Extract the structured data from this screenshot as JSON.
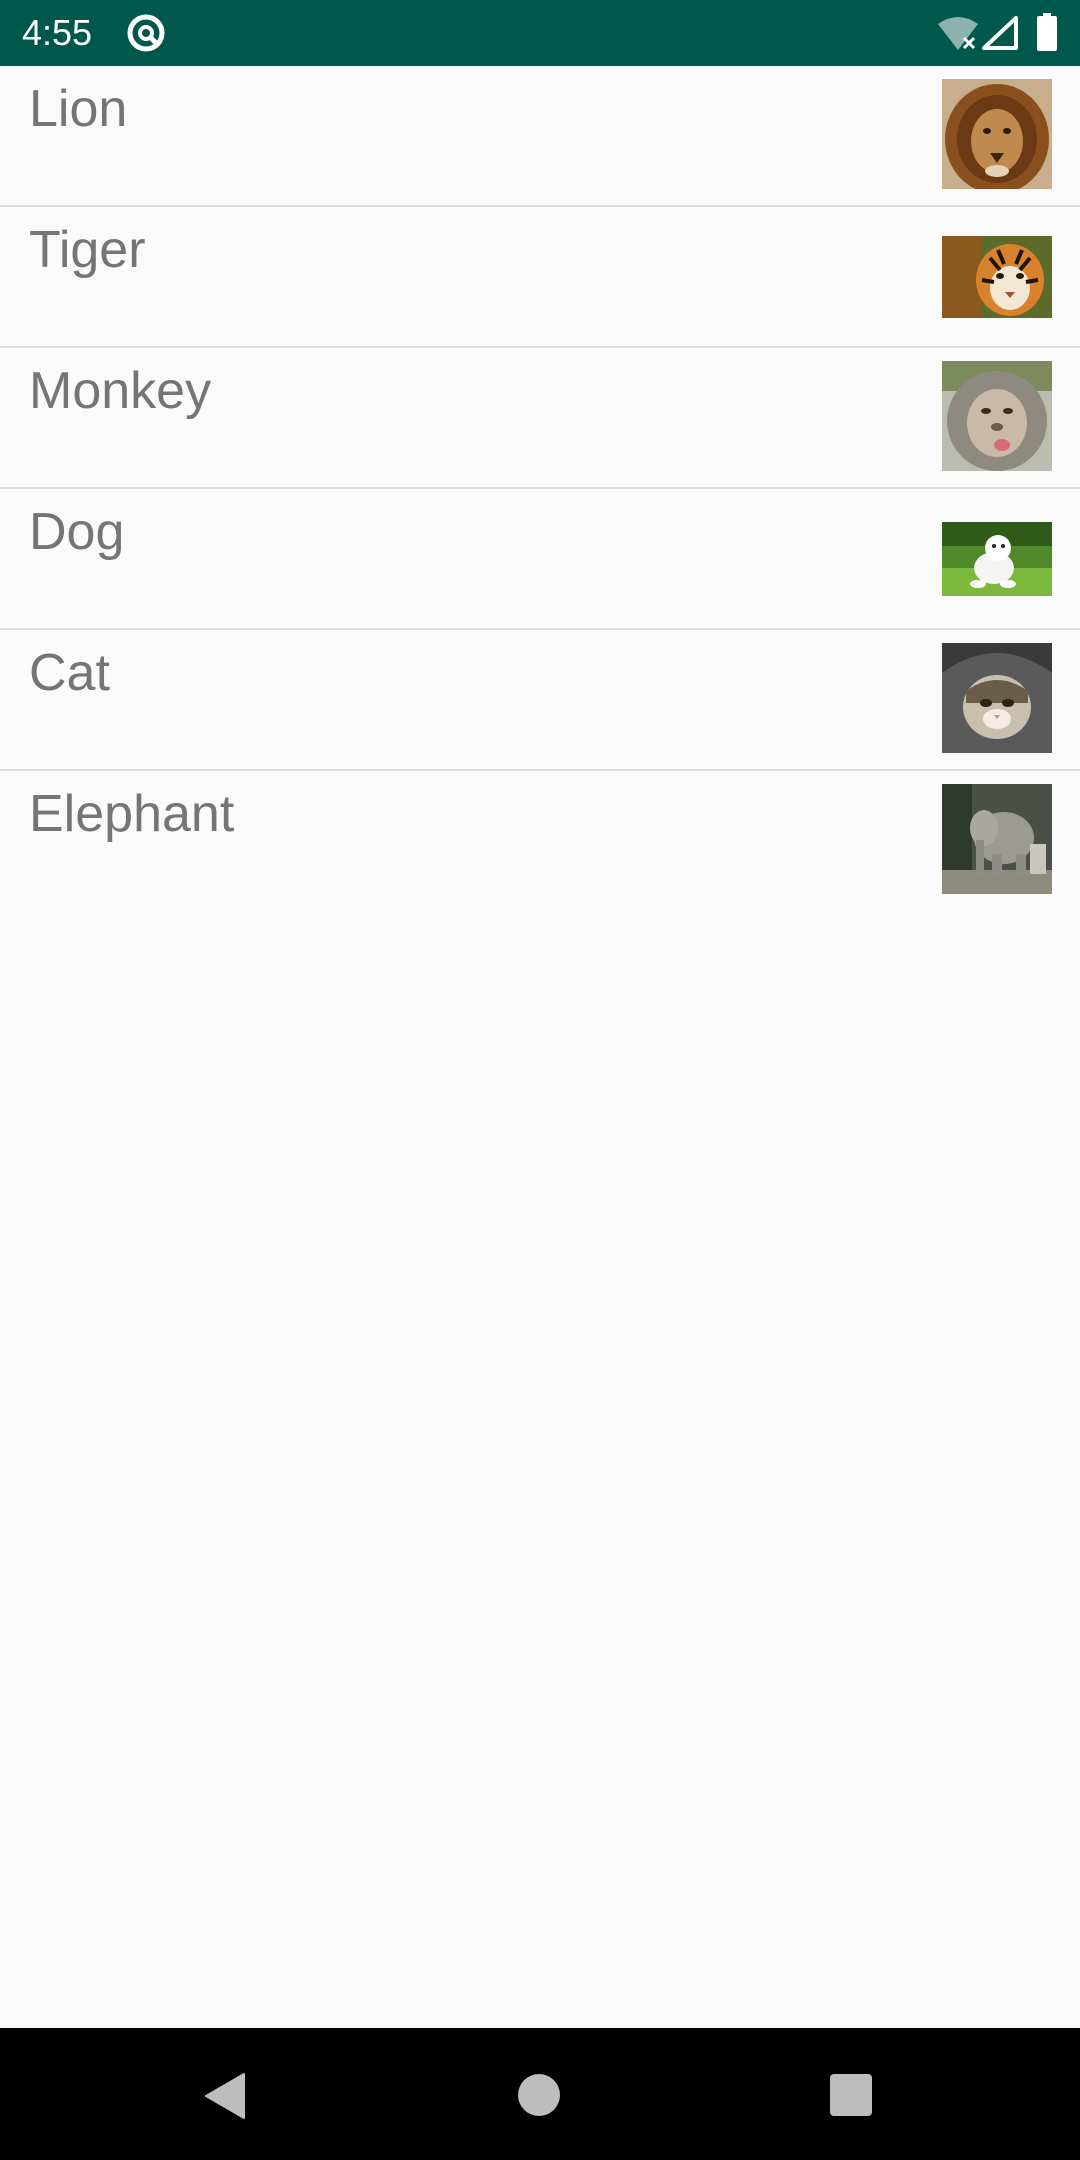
{
  "status_bar": {
    "time": "4:55",
    "background_color": "#00574b",
    "icons": [
      "app-notification-icon",
      "wifi-off-icon",
      "cell-signal-icon",
      "battery-icon"
    ]
  },
  "animals": {
    "items": [
      {
        "label": "Lion",
        "image": "lion-photo"
      },
      {
        "label": "Tiger",
        "image": "tiger-photo"
      },
      {
        "label": "Monkey",
        "image": "monkey-photo"
      },
      {
        "label": "Dog",
        "image": "dog-photo"
      },
      {
        "label": "Cat",
        "image": "cat-photo"
      },
      {
        "label": "Elephant",
        "image": "elephant-photo"
      }
    ]
  },
  "nav_bar": {
    "buttons": [
      "back-icon",
      "home-icon",
      "recents-icon"
    ]
  }
}
